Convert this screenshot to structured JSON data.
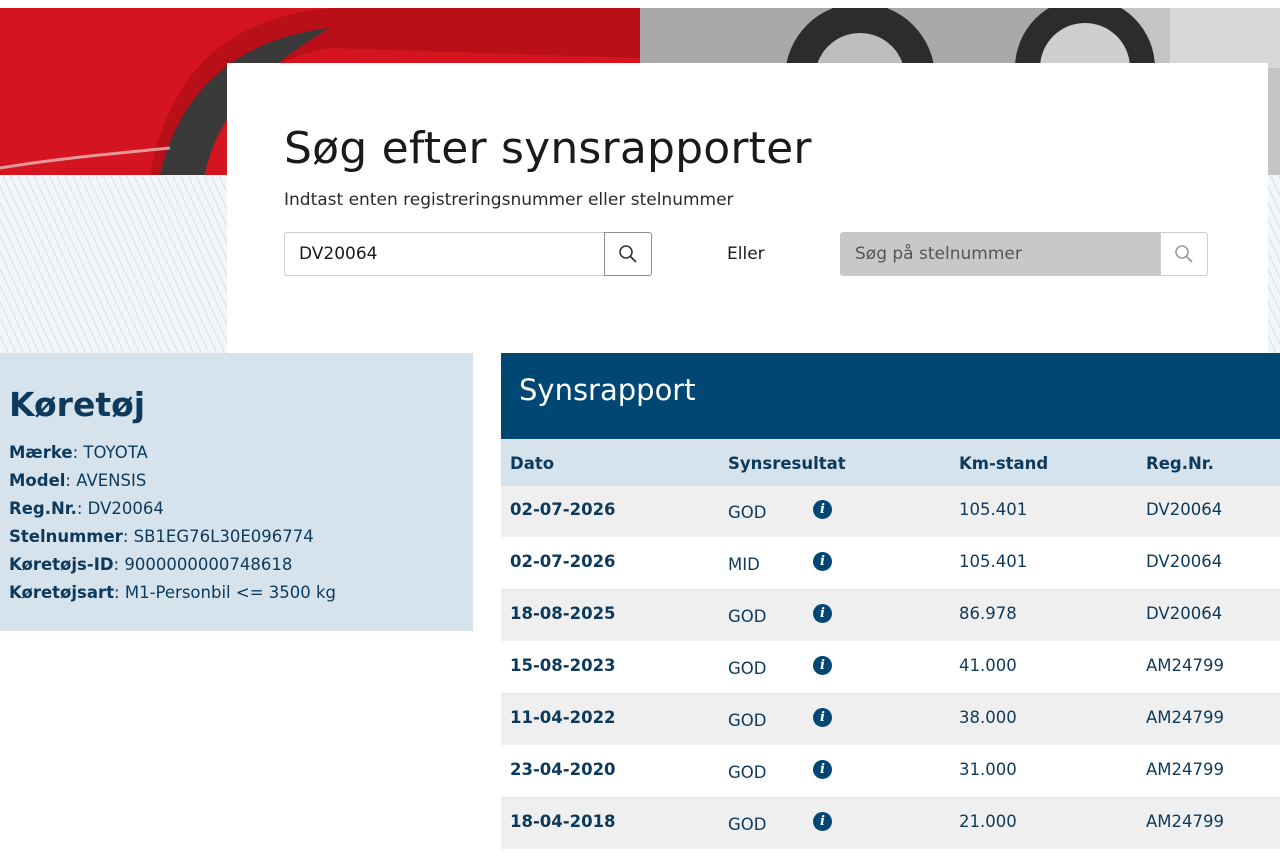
{
  "search": {
    "title": "Søg efter synsrapporter",
    "subtitle": "Indtast enten registreringsnummer eller stelnummer",
    "reg_value": "DV20064",
    "or_label": "Eller",
    "stel_placeholder": "Søg på stelnummer",
    "search_icon": "search-icon"
  },
  "vehicle": {
    "heading": "Køretøj",
    "fields": [
      {
        "label": "Mærke",
        "value": "TOYOTA"
      },
      {
        "label": "Model",
        "value": "AVENSIS"
      },
      {
        "label": "Reg.Nr.",
        "value": "DV20064"
      },
      {
        "label": "Stelnummer",
        "value": "SB1EG76L30E096774"
      },
      {
        "label": "Køretøjs-ID",
        "value": "9000000000748618"
      },
      {
        "label": "Køretøjsart",
        "value": "M1-Personbil <= 3500 kg"
      }
    ]
  },
  "report": {
    "heading": "Synsrapport",
    "columns": [
      "Dato",
      "Synsresultat",
      "Km-stand",
      "Reg.Nr."
    ],
    "info_glyph": "i",
    "rows": [
      {
        "date": "02-07-2026",
        "result": "GOD",
        "km": "105.401",
        "reg": "DV20064"
      },
      {
        "date": "02-07-2026",
        "result": "MID",
        "km": "105.401",
        "reg": "DV20064"
      },
      {
        "date": "18-08-2025",
        "result": "GOD",
        "km": "86.978",
        "reg": "DV20064"
      },
      {
        "date": "15-08-2023",
        "result": "GOD",
        "km": "41.000",
        "reg": "AM24799"
      },
      {
        "date": "11-04-2022",
        "result": "GOD",
        "km": "38.000",
        "reg": "AM24799"
      },
      {
        "date": "23-04-2020",
        "result": "GOD",
        "km": "31.000",
        "reg": "AM24799"
      },
      {
        "date": "18-04-2018",
        "result": "GOD",
        "km": "21.000",
        "reg": "AM24799"
      }
    ]
  },
  "colors": {
    "primary": "#004774",
    "panel": "#d6e2ec",
    "text": "#0d3a5c"
  }
}
